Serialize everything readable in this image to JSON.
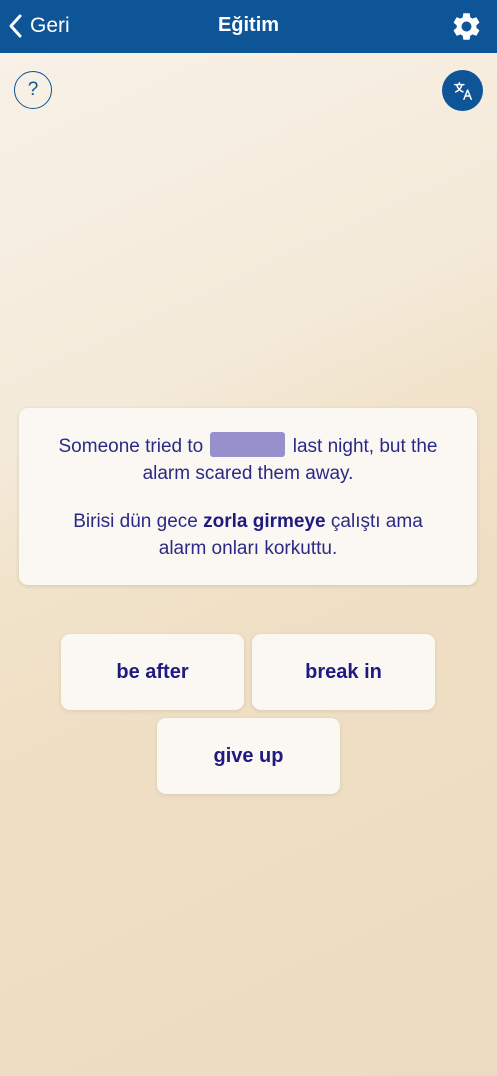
{
  "header": {
    "back_label": "Geri",
    "title": "Eğitim"
  },
  "help_button": {
    "label": "?"
  },
  "translate_button": {
    "icon": "translate-icon"
  },
  "settings_button": {
    "icon": "gear-icon"
  },
  "card": {
    "sentence_before": "Someone tried to",
    "sentence_after": "last night, but the alarm scared them away.",
    "translation_before": "Birisi dün gece",
    "translation_highlight": "zorla girmeye",
    "translation_after": "çalıştı ama alarm onları korkuttu."
  },
  "options": [
    {
      "label": "be after"
    },
    {
      "label": "break in"
    },
    {
      "label": "give up"
    }
  ],
  "colors": {
    "header": "#0d5597",
    "text": "#2a2a86",
    "blank": "#9691cd",
    "card": "#fbf8f3"
  }
}
